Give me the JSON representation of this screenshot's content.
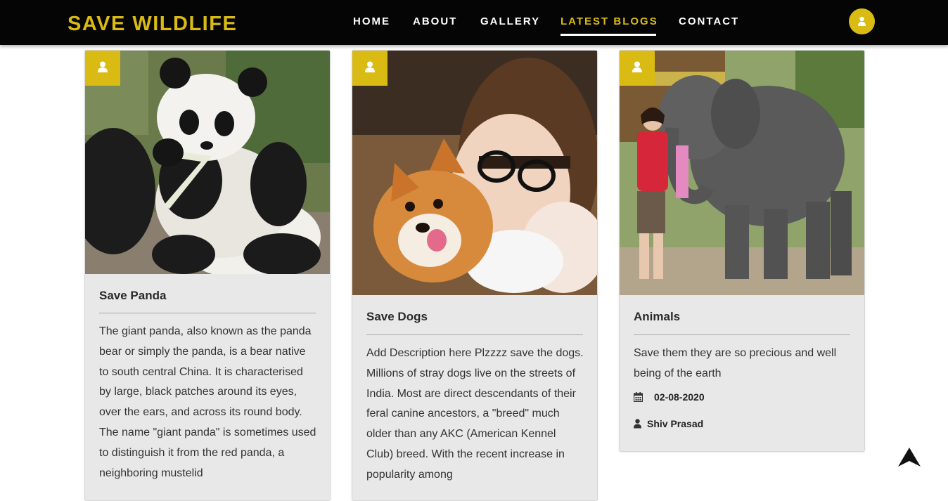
{
  "navbar": {
    "brand": "SAVE WILDLIFE",
    "links": [
      "HOME",
      "ABOUT",
      "GALLERY",
      "LATEST BLOGS",
      "CONTACT"
    ],
    "active": "LATEST BLOGS",
    "avatar_icon": "user-icon"
  },
  "cards": [
    {
      "image": "panda-photo",
      "badge_icon": "user-icon",
      "title": "Save Panda",
      "description": "The giant panda, also known as the panda bear or simply the panda, is a bear native to south central China. It is characterised by large, black patches around its eyes, over the ears, and across its round body. The name \"giant panda\" is sometimes used to distinguish it from the red panda, a neighboring mustelid"
    },
    {
      "image": "dog-photo",
      "badge_icon": "user-icon",
      "title": "Save Dogs",
      "description": "Add Description here Plzzzz save the dogs. Millions of stray dogs live on the streets of India. Most are direct descendants of their feral canine ancestors, a \"breed\" much older than any AKC (American Kennel Club) breed. With the recent increase in popularity among"
    },
    {
      "image": "elephant-photo",
      "badge_icon": "user-icon",
      "title": "Animals",
      "description": "Save them they are so precious and well being of the earth",
      "date": "02-08-2020",
      "author": "Shiv Prasad"
    }
  ],
  "scroll_top_icon": "arrow-up-icon",
  "colors": {
    "accent": "#d9bb13",
    "navbar": "#050505",
    "card": "#e8e8e8"
  }
}
